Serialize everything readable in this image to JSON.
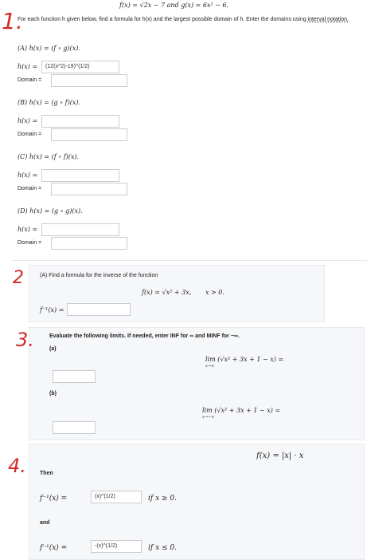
{
  "header": {
    "function_defs": "f(x) = √2x − 7  and  g(x) = 6x² − 6."
  },
  "problem1": {
    "instructions": "For each function h given below, find a formula for h(x) and the largest possible domain of h. Enter the domains using",
    "link_text": "interval notation.",
    "partA": {
      "title": "(A) h(x) = (f ∘ g)(x).",
      "h_label": "h(x) =",
      "h_value": "(12(x^2)-19)^(1/2)",
      "domain_label": "Domain =",
      "domain_value": ""
    },
    "partB": {
      "title": "(B) h(x) = (g ∘ f)(x).",
      "h_label": "h(x) =",
      "h_value": "",
      "domain_label": "Domain =",
      "domain_value": ""
    },
    "partC": {
      "title": "(C) h(x) = (f ∘ f)(x).",
      "h_label": "h(x) =",
      "h_value": "",
      "domain_label": "Domain =",
      "domain_value": ""
    },
    "partD": {
      "title": "(D) h(x) = (g ∘ g)(x).",
      "h_label": "h(x) =",
      "h_value": "",
      "domain_label": "Domain =",
      "domain_value": ""
    }
  },
  "problem2": {
    "title": "(A) Find a formula for the inverse of the function",
    "function": "f(x) = √x² + 3x,",
    "condition": "x > 0.",
    "inverse_label": "f⁻¹(x) =",
    "inverse_value": ""
  },
  "problem3": {
    "instructions": "Evaluate the following limits. If needed, enter INF for ∞ and MINF for −∞.",
    "partA_label": "(a)",
    "limitA": "lim (√x² + 3x + 1 − x) =",
    "limitA_sub": "x→∞",
    "partB_label": "(b)",
    "limitB": "lim (√x² + 3x + 1 − x) =",
    "limitB_sub": "x→−∞",
    "answerA": "",
    "answerB": ""
  },
  "problem4": {
    "function": "f(x) = |x| · x",
    "then_label": "Then",
    "inv1_label": "f⁻¹(x) =",
    "inv1_value": "(x)^(1/2)",
    "inv1_cond": "if x ≥ 0.",
    "and_label": "and",
    "inv2_label": "f⁻¹(x) =",
    "inv2_value": "-(x)^(1/2)",
    "inv2_cond": "if x ≤ 0."
  },
  "handwriting": {
    "n1": "1.",
    "n2": "2",
    "n3": "3.",
    "n4": "4."
  }
}
